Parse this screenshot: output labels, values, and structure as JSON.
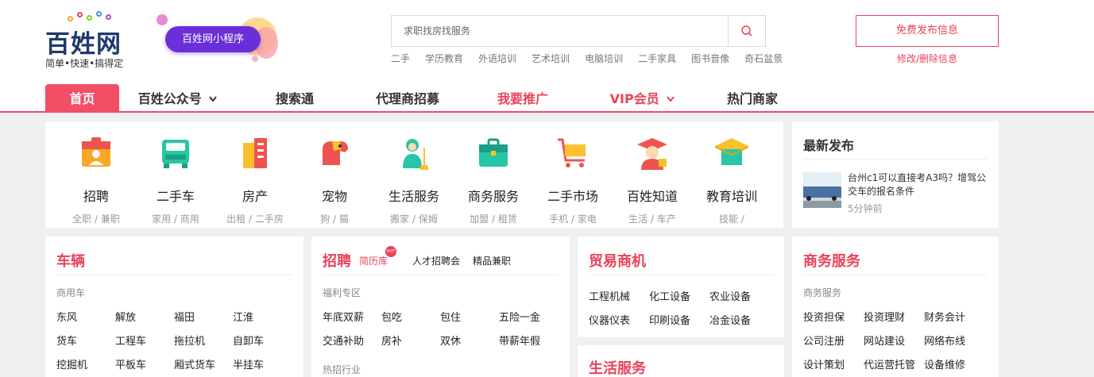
{
  "header": {
    "logo_text": "百姓网",
    "slogan": "简单•快速•搞得定",
    "mini_program": "百姓网小程序",
    "search": {
      "placeholder": "求职找房找服务"
    },
    "hot_words": [
      "二手",
      "学历教育",
      "外语培训",
      "艺术培训",
      "电脑培训",
      "二手家具",
      "图书音像",
      "奇石盆景"
    ],
    "publish_label": "免费发布信息",
    "edit_label": "修改/删除信息"
  },
  "nav": {
    "items": [
      "首页",
      "百姓公众号",
      "搜索通",
      "代理商招募",
      "我要推广",
      "VIP会员",
      "热门商家"
    ]
  },
  "categories": [
    {
      "name": "招聘",
      "sub": "全职 / 兼职",
      "icon": "recruit-icon"
    },
    {
      "name": "二手车",
      "sub": "家用 / 商用",
      "icon": "car-icon"
    },
    {
      "name": "房产",
      "sub": "出租 / 二手房",
      "icon": "building-icon"
    },
    {
      "name": "宠物",
      "sub": "狗 / 猫",
      "icon": "dog-icon"
    },
    {
      "name": "生活服务",
      "sub": "搬家 / 保姆",
      "icon": "cleaner-icon"
    },
    {
      "name": "商务服务",
      "sub": "加盟 / 租赁",
      "icon": "briefcase-icon"
    },
    {
      "name": "二手市场",
      "sub": "手机 / 家电",
      "icon": "cart-icon"
    },
    {
      "name": "百姓知道",
      "sub": "生活 / 车产",
      "icon": "graduate-icon"
    },
    {
      "name": "教育培训",
      "sub": "技能 /",
      "icon": "grad-cap-icon"
    }
  ],
  "latest": {
    "title": "最新发布",
    "item_text": "台州c1可以直接考A3吗？增驾公交车的报名条件",
    "item_time": "5分钟前"
  },
  "vehicles": {
    "title": "车辆",
    "group": "商用车",
    "rows": [
      [
        "东风",
        "解放",
        "福田",
        "江淮"
      ],
      [
        "货车",
        "工程车",
        "拖拉机",
        "自卸车"
      ],
      [
        "挖掘机",
        "平板车",
        "厢式货车",
        "半挂车"
      ]
    ]
  },
  "recruit": {
    "title": "招聘",
    "links": [
      "简历库",
      "人才招聘会",
      "精品兼职"
    ],
    "hot_badge": "HOT",
    "group1": "福利专区",
    "rows": [
      [
        "年底双薪",
        "包吃",
        "包住",
        "五险一金"
      ],
      [
        "交通补助",
        "房补",
        "双休",
        "带薪年假"
      ]
    ],
    "group2": "热招行业"
  },
  "trade": {
    "title": "贸易商机",
    "rows": [
      [
        "工程机械",
        "化工设备",
        "农业设备"
      ],
      [
        "仪器仪表",
        "印刷设备",
        "冶金设备"
      ]
    ],
    "title2": "生活服务"
  },
  "business": {
    "title": "商务服务",
    "group": "商务服务",
    "rows": [
      [
        "投资担保",
        "投资理财",
        "财务会计"
      ],
      [
        "公司注册",
        "网站建设",
        "网络布线"
      ],
      [
        "设计策划",
        "代运营托管",
        "设备维修"
      ]
    ]
  },
  "colors": {
    "accent": "#e8435a",
    "nav_active": "#f24e64",
    "purple": "#6a2fd8",
    "logo": "#1d3a6e"
  }
}
